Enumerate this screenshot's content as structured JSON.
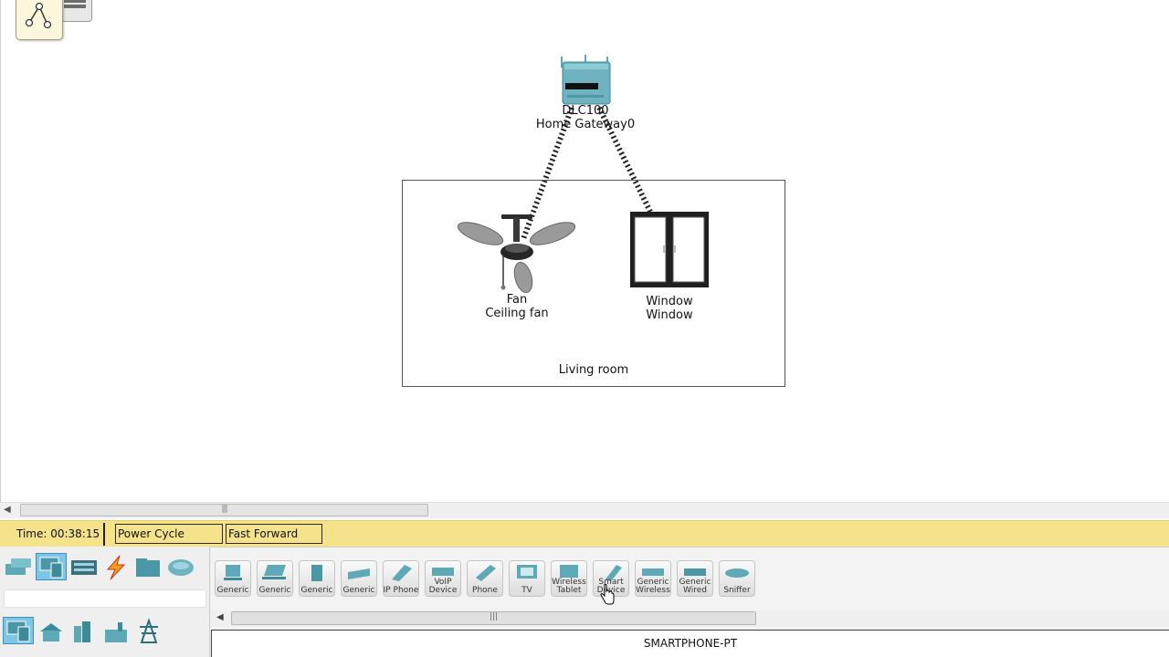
{
  "workspace": {
    "gateway": {
      "model": "DLC100",
      "name": "Home Gateway0"
    },
    "fan": {
      "name": "Fan",
      "model": "Ceiling fan"
    },
    "window": {
      "name": "Window",
      "model": "Window"
    },
    "cluster": {
      "label": "Living room"
    }
  },
  "timebar": {
    "time": "Time: 00:38:15",
    "power_cycle": "Power Cycle Devices",
    "fast_forward": "Fast Forward Time"
  },
  "categories": {
    "top": [
      "network-devices-icon",
      "end-devices-icon",
      "components-icon",
      "connections-icon",
      "miscellaneous-icon",
      "multiuser-icon"
    ],
    "bottom": [
      "end-devices-icon",
      "home-icon",
      "smart-city-icon",
      "industrial-icon",
      "power-grid-icon"
    ]
  },
  "devices": [
    {
      "top": "",
      "bottom": "Generic"
    },
    {
      "top": "",
      "bottom": "Generic"
    },
    {
      "top": "",
      "bottom": "Generic"
    },
    {
      "top": "",
      "bottom": "Generic"
    },
    {
      "top": "",
      "bottom": "IP Phone"
    },
    {
      "top": "VoIP",
      "bottom": "Device"
    },
    {
      "top": "",
      "bottom": "Phone"
    },
    {
      "top": "",
      "bottom": "TV"
    },
    {
      "top": "Wireless",
      "bottom": "Tablet"
    },
    {
      "top": "Smart",
      "bottom": "Device"
    },
    {
      "top": "Generic",
      "bottom": "Wireless"
    },
    {
      "top": "Generic",
      "bottom": "Wired"
    },
    {
      "top": "",
      "bottom": "Sniffer"
    }
  ],
  "status": {
    "selected_model": "SMARTPHONE-PT"
  },
  "colors": {
    "timebar": "#f5e38b",
    "selected_category": "#7fc6e6",
    "device_teal": "#5ea9b8"
  }
}
